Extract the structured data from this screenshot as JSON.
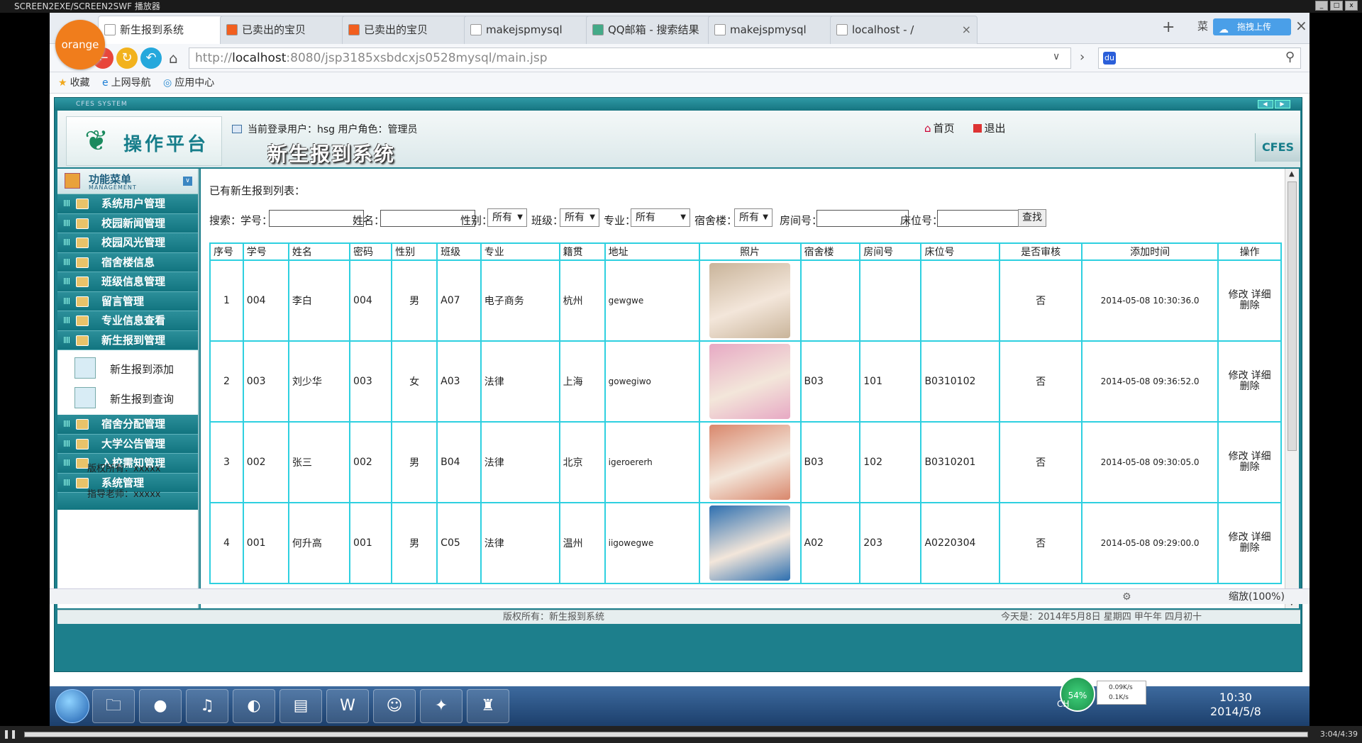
{
  "window": {
    "title": "SCREEN2EXE/SCREEN2SWF 播放器"
  },
  "browser": {
    "logo": "orange",
    "tabs": [
      {
        "label": "新生报到系统",
        "icon": "page-icon",
        "active": true
      },
      {
        "label": "已卖出的宝贝",
        "icon": "taobao-icon",
        "active": false
      },
      {
        "label": "已卖出的宝贝",
        "icon": "taobao-icon",
        "active": false
      },
      {
        "label": "makejspmysql",
        "icon": "page-icon",
        "active": false
      },
      {
        "label": "QQ邮箱 - 搜索结果",
        "icon": "chrome-icon",
        "active": false
      },
      {
        "label": "makejspmysql",
        "icon": "page-icon",
        "active": false
      },
      {
        "label": "localhost - /",
        "icon": "page-icon",
        "active": false
      }
    ],
    "tab_more": "菜",
    "upload_label": "拖拽上传",
    "url_prefix": "http://",
    "url_host": "localhost",
    "url_rest": ":8080/jsp3185xsbdcxjs0528mysql/main.jsp",
    "favorites": [
      {
        "label": "收藏",
        "icon": "star-icon"
      },
      {
        "label": "上网导航",
        "icon": "ie-icon"
      },
      {
        "label": "应用中心",
        "icon": "apps-icon"
      }
    ],
    "zoom": "缩放(100%)"
  },
  "app": {
    "frame_caption": "CFES SYSTEM",
    "brand": "操作平台",
    "system_title": "新生报到系统",
    "user_label": "当前登录用户：hsg  用户角色：管理员",
    "home_link": "首页",
    "logout_link": "退出",
    "cfes_badge": "CFES"
  },
  "sidebar": {
    "title": "功能菜单",
    "subtitle": "MANAGEMENT",
    "items": [
      "系统用户管理",
      "校园新闻管理",
      "校园风光管理",
      "宿舍楼信息",
      "班级信息管理",
      "留言管理",
      "专业信息查看",
      "新生报到管理"
    ],
    "subitems": [
      "新生报到添加",
      "新生报到查询"
    ],
    "items_after": [
      "宿舍分配管理",
      "大学公告管理",
      "入校需知管理",
      "系统管理"
    ],
    "copyright": "版权所有：xxxxx",
    "advisor": "指导老师：xxxxx"
  },
  "content": {
    "list_title": "已有新生报到列表：",
    "search": {
      "label": "搜索：",
      "f_xuehao": "学号：",
      "f_name": "姓名：",
      "f_gender": "性别：",
      "gender_value": "所有",
      "f_class": "班级：",
      "class_value": "所有",
      "f_major": "专业：",
      "major_value": "所有",
      "f_dorm": "宿舍楼：",
      "dorm_value": "所有",
      "f_room": "房间号：",
      "f_bed": "床位号：",
      "button": "查找"
    },
    "columns": [
      "序号",
      "学号",
      "姓名",
      "密码",
      "性别",
      "班级",
      "专业",
      "籍贯",
      "地址",
      "照片",
      "宿舍楼",
      "房间号",
      "床位号",
      "是否审核",
      "添加时间",
      "操作"
    ],
    "rows": [
      {
        "no": "1",
        "xh": "004",
        "name": "李白",
        "pwd": "004",
        "gender": "男",
        "cls": "A07",
        "major": "电子商务",
        "origin": "杭州",
        "addr": "gewgwe",
        "dorm": "",
        "room": "",
        "bed": "",
        "audit": "否",
        "time": "2014-05-08 10:30:36.0",
        "photo": "#c9b49a"
      },
      {
        "no": "2",
        "xh": "003",
        "name": "刘少华",
        "pwd": "003",
        "gender": "女",
        "cls": "A03",
        "major": "法律",
        "origin": "上海",
        "addr": "gowegiwo",
        "dorm": "B03",
        "room": "101",
        "bed": "B0310102",
        "audit": "否",
        "time": "2014-05-08 09:36:52.0",
        "photo": "#e7a9c4"
      },
      {
        "no": "3",
        "xh": "002",
        "name": "张三",
        "pwd": "002",
        "gender": "男",
        "cls": "B04",
        "major": "法律",
        "origin": "北京",
        "addr": "igeroererh",
        "dorm": "B03",
        "room": "102",
        "bed": "B0310201",
        "audit": "否",
        "time": "2014-05-08 09:30:05.0",
        "photo": "#d9876c"
      },
      {
        "no": "4",
        "xh": "001",
        "name": "何升高",
        "pwd": "001",
        "gender": "男",
        "cls": "C05",
        "major": "法律",
        "origin": "温州",
        "addr": "iigowegwe",
        "dorm": "A02",
        "room": "203",
        "bed": "A0220304",
        "audit": "否",
        "time": "2014-05-08 09:29:00.0",
        "photo": "#2d6fb0"
      }
    ],
    "op_edit": "修改",
    "op_detail": "详细",
    "op_delete": "删除"
  },
  "status": {
    "copyright": "版权所有：新生报到系统",
    "date": "今天是：2014年5月8日 星期四 甲午年 四月初十"
  },
  "taskbar": {
    "lang": "CH",
    "net_percent": "54%",
    "up_speed": "0.09K/s",
    "down_speed": "0.1K/s",
    "time": "10:30",
    "date": "2014/5/8"
  },
  "player": {
    "time": "3:04/4:39"
  }
}
